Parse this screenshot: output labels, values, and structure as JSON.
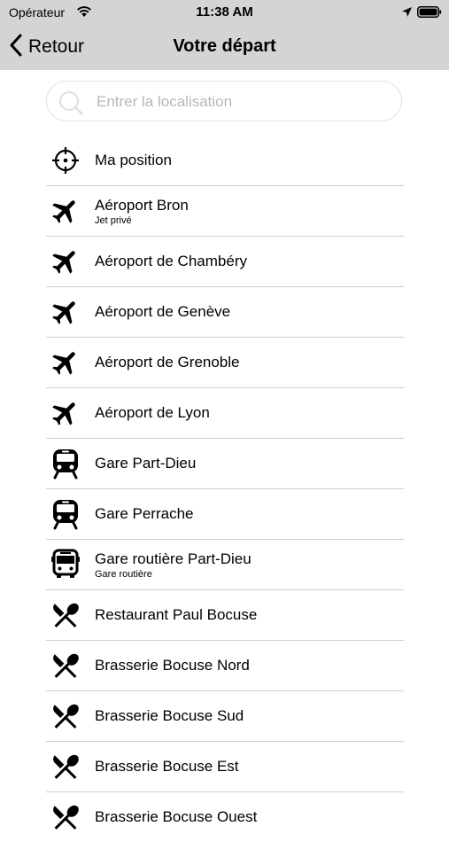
{
  "status_bar": {
    "carrier": "Opérateur",
    "time": "11:38 AM"
  },
  "nav": {
    "back_label": "Retour",
    "title": "Votre départ"
  },
  "search": {
    "placeholder": "Entrer la localisation",
    "value": ""
  },
  "locations": [
    {
      "icon": "crosshair-icon",
      "title": "Ma position",
      "subtitle": ""
    },
    {
      "icon": "airplane-icon",
      "title": "Aéroport Bron",
      "subtitle": "Jet privé"
    },
    {
      "icon": "airplane-icon",
      "title": "Aéroport de Chambéry",
      "subtitle": ""
    },
    {
      "icon": "airplane-icon",
      "title": "Aéroport de Genève",
      "subtitle": ""
    },
    {
      "icon": "airplane-icon",
      "title": "Aéroport de Grenoble",
      "subtitle": ""
    },
    {
      "icon": "airplane-icon",
      "title": "Aéroport de Lyon",
      "subtitle": ""
    },
    {
      "icon": "train-icon",
      "title": "Gare Part-Dieu",
      "subtitle": ""
    },
    {
      "icon": "train-icon",
      "title": "Gare Perrache",
      "subtitle": ""
    },
    {
      "icon": "bus-icon",
      "title": "Gare routière Part-Dieu",
      "subtitle": "Gare routière"
    },
    {
      "icon": "restaurant-icon",
      "title": "Restaurant Paul Bocuse",
      "subtitle": ""
    },
    {
      "icon": "restaurant-icon",
      "title": "Brasserie Bocuse Nord",
      "subtitle": ""
    },
    {
      "icon": "restaurant-icon",
      "title": "Brasserie Bocuse Sud",
      "subtitle": ""
    },
    {
      "icon": "restaurant-icon",
      "title": "Brasserie Bocuse Est",
      "subtitle": ""
    },
    {
      "icon": "restaurant-icon",
      "title": "Brasserie Bocuse Ouest",
      "subtitle": ""
    }
  ]
}
